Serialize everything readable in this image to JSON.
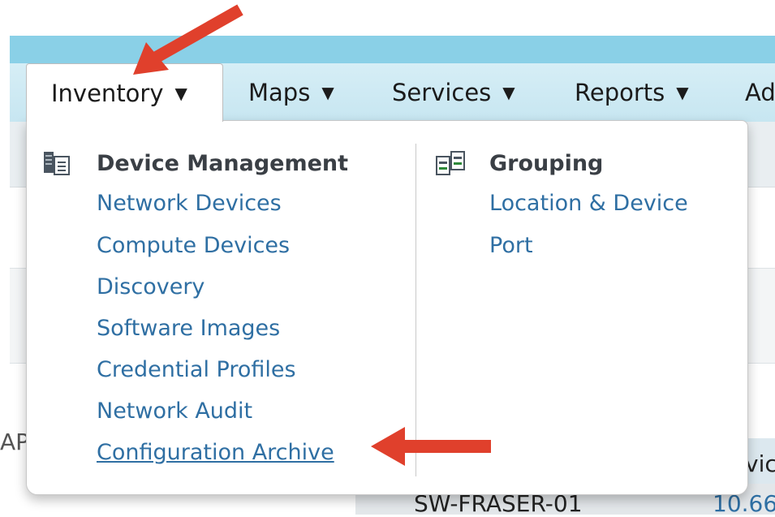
{
  "nav": {
    "tabs": [
      {
        "label": "Inventory",
        "caret": "▼",
        "active": true
      },
      {
        "label": "Maps",
        "caret": "▼"
      },
      {
        "label": "Services",
        "caret": "▼"
      },
      {
        "label": "Reports",
        "caret": "▼"
      },
      {
        "label": "Ad"
      }
    ]
  },
  "dropdown": {
    "device_management": {
      "heading": "Device Management",
      "icon": "device-management-icon",
      "items": [
        "Network Devices",
        "Compute Devices",
        "Discovery",
        "Software Images",
        "Credential Profiles",
        "Network Audit",
        "Configuration Archive"
      ]
    },
    "grouping": {
      "heading": "Grouping",
      "icon": "grouping-icon",
      "items": [
        "Location & Device",
        "Port"
      ]
    }
  },
  "background": {
    "left_fragment": "AP",
    "device_name": "SW-FRASER-01",
    "ip_fragment": "10.66",
    "column_fragment": "vic"
  },
  "colors": {
    "link": "#2f6fa3",
    "arrow": "#e0402c",
    "navbar": "#c7e6f1"
  }
}
